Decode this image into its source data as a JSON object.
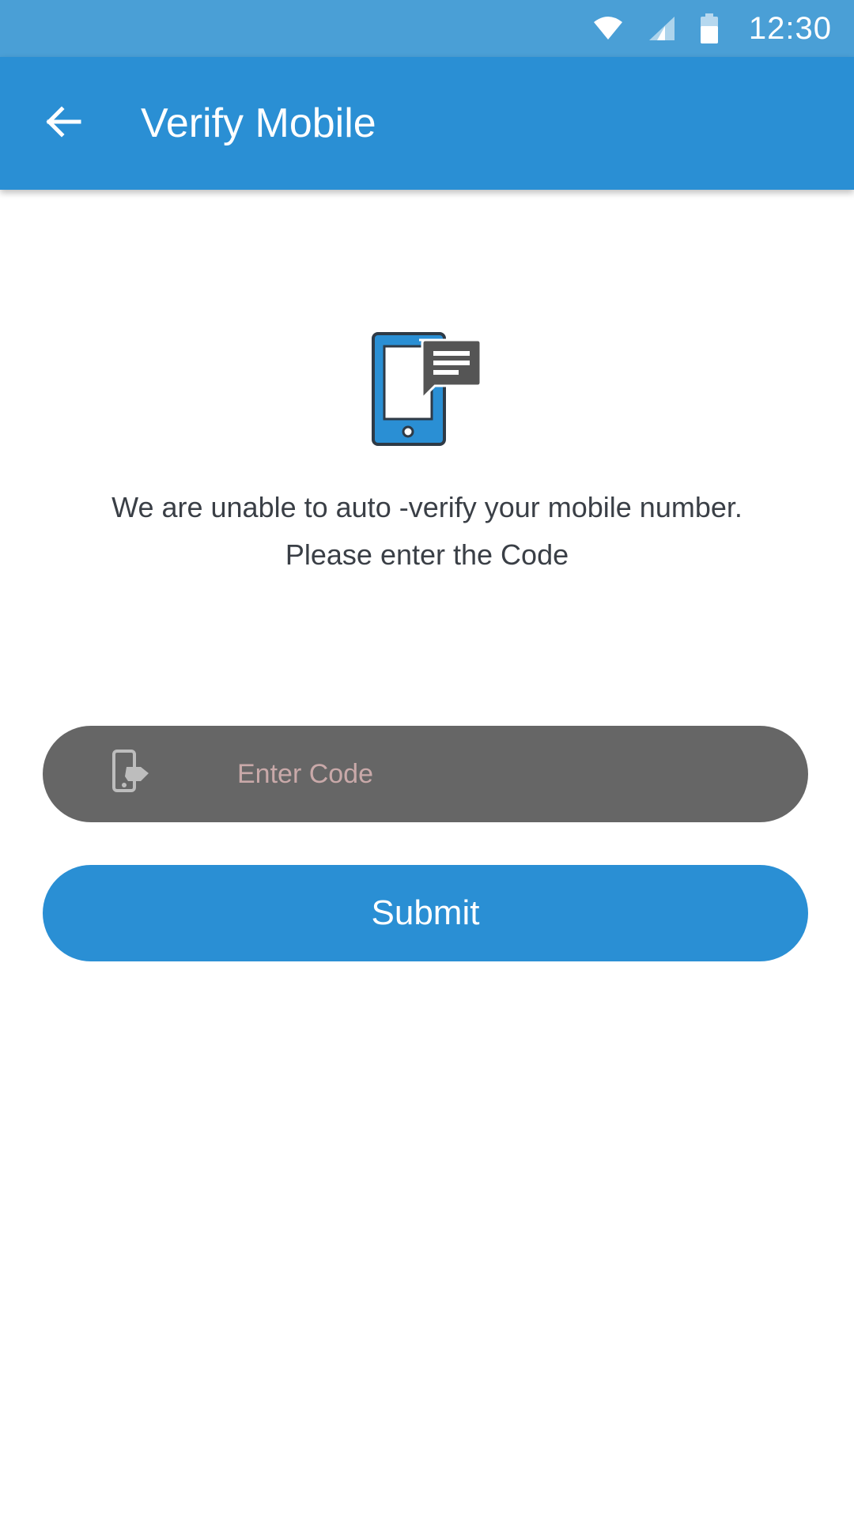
{
  "status_bar": {
    "time": "12:30",
    "icons": [
      "wifi-icon",
      "cell-signal-icon",
      "battery-icon"
    ]
  },
  "app_bar": {
    "back_icon": "arrow-left-icon",
    "title": "Verify Mobile"
  },
  "content": {
    "illustration_icon": "phone-message-icon",
    "message_line1": "We are unable to auto -verify your mobile number.",
    "message_line2": "Please enter the Code"
  },
  "code_field": {
    "icon": "phone-tap-icon",
    "placeholder": "Enter Code",
    "value": ""
  },
  "submit": {
    "label": "Submit"
  },
  "colors": {
    "status_bar": "#4a9fd6",
    "primary": "#2a8fd4",
    "input_background": "#666666",
    "placeholder": "#c9a9a9",
    "body_text": "#3a3f46",
    "icon_dark": "#555555"
  }
}
